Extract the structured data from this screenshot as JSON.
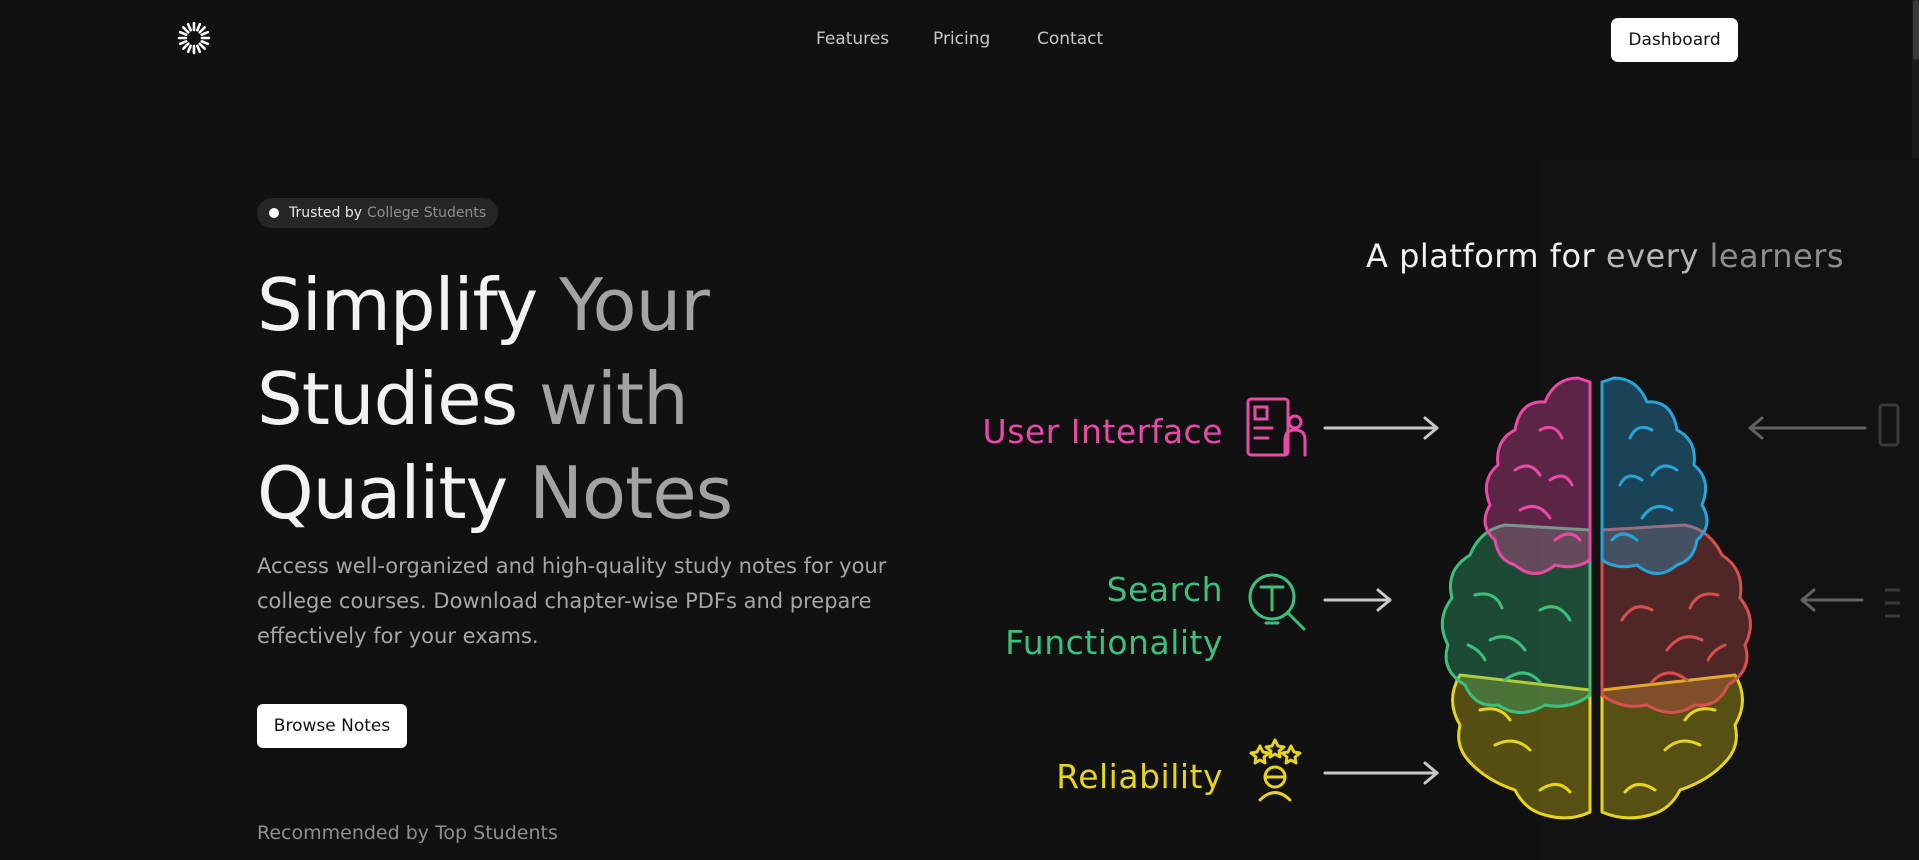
{
  "nav": {
    "links": [
      "Features",
      "Pricing",
      "Contact"
    ],
    "dashboard_label": "Dashboard"
  },
  "hero": {
    "badge": {
      "strong": "Trusted by",
      "muted": "College Students"
    },
    "headline": {
      "line1_a": "Simplify ",
      "line1_b": "Your",
      "line2_a": "Studies ",
      "line2_b": "with",
      "line3_a": "Quality ",
      "line3_b": "Notes"
    },
    "description": "Access well-organized and high-quality study notes for your college courses. Download chapter-wise PDFs and prepare effectively for your exams.",
    "browse_label": "Browse Notes",
    "recommended": "Recommended by Top Students"
  },
  "illustration": {
    "title_a": "A platform for ",
    "title_b": "every ",
    "title_c": "learners",
    "features": {
      "ui": "User Interface",
      "search_line1": "Search",
      "search_line2": "Functionality",
      "reliability": "Reliability"
    },
    "colors": {
      "pink": "#e84aa6",
      "green": "#3cc07e",
      "yellow": "#e7d41c",
      "blue": "#2aa3d8",
      "red": "#d65050"
    },
    "icons": [
      "profile-card-icon",
      "search-magnifier-icon",
      "stars-person-icon",
      "sun-logo-icon"
    ]
  }
}
